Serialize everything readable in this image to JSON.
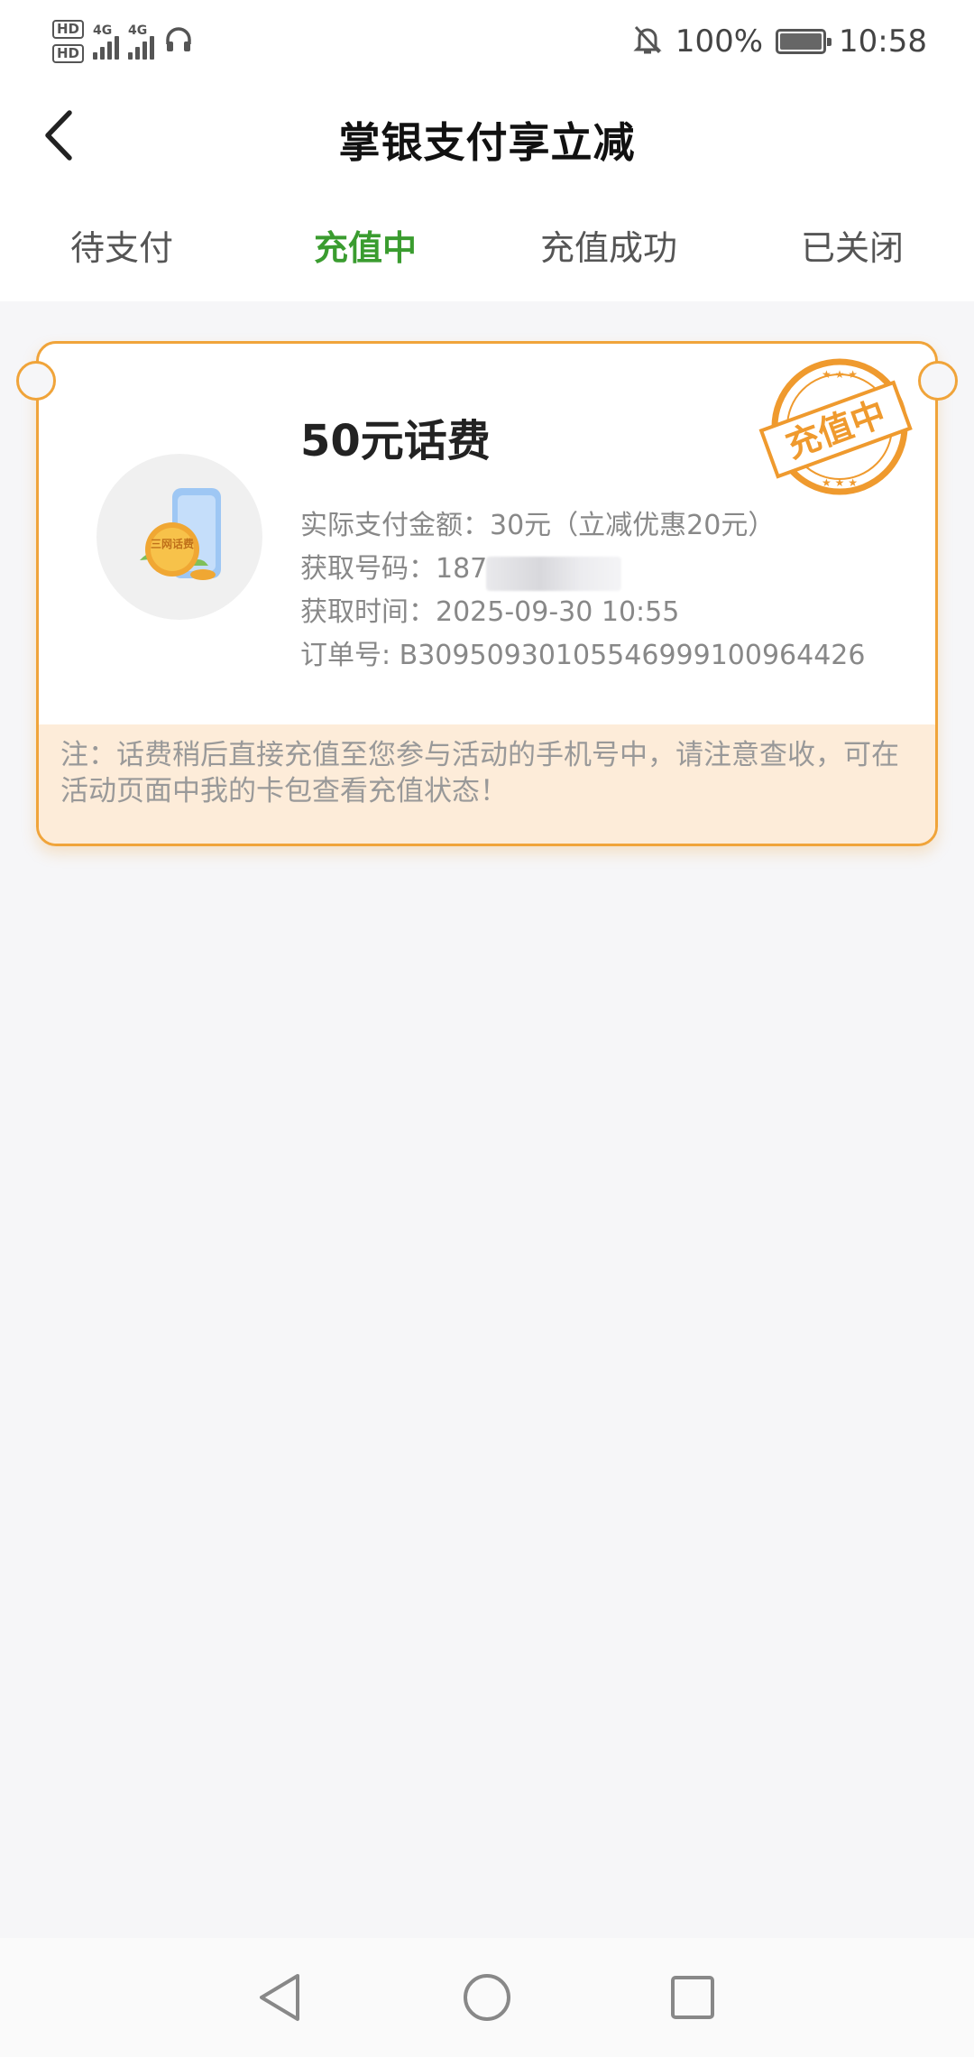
{
  "status_bar": {
    "sim1": "HD",
    "sim2": "HD",
    "net1": "4G",
    "net2": "4G",
    "battery_text": "100%",
    "battery_level": 1.0,
    "time": "10:58",
    "icons": [
      "headphones-icon",
      "silent-bell-icon",
      "battery-icon"
    ]
  },
  "header": {
    "title": "掌银支付享立减"
  },
  "tabs": [
    {
      "label": "待支付",
      "active": false
    },
    {
      "label": "充值中",
      "active": true
    },
    {
      "label": "充值成功",
      "active": false
    },
    {
      "label": "已关闭",
      "active": false
    }
  ],
  "order": {
    "title": "50元话费",
    "product_icon_label": "三网话费",
    "paid_amount": "实际支付金额：30元（立减优惠20元）",
    "phone": "获取号码：187",
    "time": "获取时间：2025-09-30 10:55",
    "order_no": "订单号: B30950930105546999100964426",
    "stamp": "充值中",
    "note": "注：话费稍后直接充值至您参与活动的手机号中，请注意查收，可在活动页面中我的卡包查看充值状态！"
  },
  "colors": {
    "accent_green": "#3a9c2f",
    "card_border": "#f0a43a",
    "note_bg": "#fdecd9",
    "stamp": "#ef9a2e"
  },
  "nav_bar": {
    "buttons": [
      "back-triangle-icon",
      "home-circle-icon",
      "recents-square-icon"
    ]
  }
}
